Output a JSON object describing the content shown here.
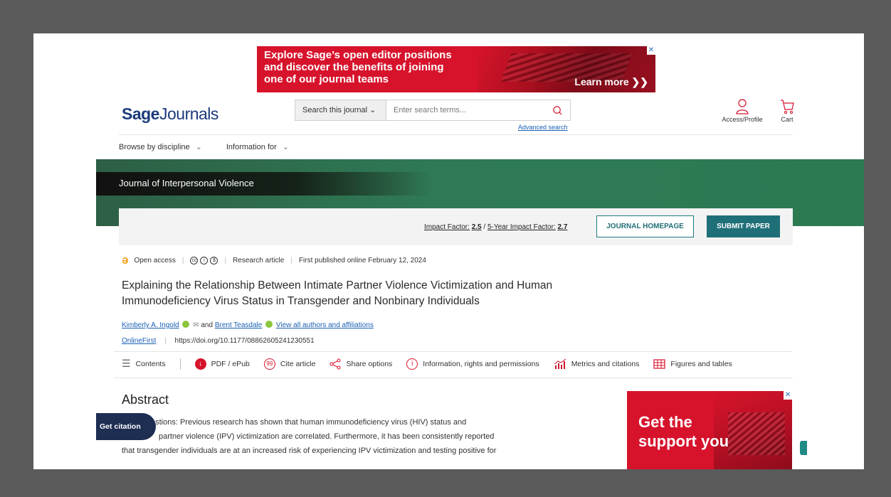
{
  "ad_banner": {
    "line1": "Explore Sage’s open editor positions",
    "line2": "and discover the benefits of joining",
    "line3": "one of our journal teams",
    "cta": "Learn more ❯❯",
    "close": "✕"
  },
  "header": {
    "logo_bold": "Sage",
    "logo_rest": "Journals",
    "search_scope": "Search this journal ⌄",
    "search_placeholder": "Enter search terms...",
    "advanced_search": "Advanced search",
    "access_label": "Access/Profile",
    "cart_label": "Cart"
  },
  "nav": {
    "browse": "Browse by discipline",
    "info_for": "Information for"
  },
  "journal": {
    "name": "Journal of Interpersonal Violence",
    "impact_label": "Impact Factor:",
    "impact_value": "2.5",
    "five_year_label": "5-Year Impact Factor:",
    "five_year_value": "2.7",
    "homepage_button": "JOURNAL HOMEPAGE",
    "submit_button": "SUBMIT PAPER"
  },
  "article": {
    "access": "Open access",
    "type": "Research article",
    "published": "First published online February 12, 2024",
    "title_line1": "Explaining the Relationship Between Intimate Partner Violence Victimization and Human",
    "title_line2": "Immunodeficiency Virus Status in Transgender and Nonbinary Individuals",
    "author1": "Kimberly A. Ingold",
    "and": "and",
    "author2": "Brent Teasdale",
    "all_authors": "View all authors and affiliations",
    "status": "OnlineFirst",
    "doi": "https://doi.org/10.1177/08862605241230551"
  },
  "tools": {
    "contents": "Contents",
    "pdf": "PDF / ePub",
    "cite": "Cite article",
    "share": "Share options",
    "info": "Information, rights and permissions",
    "metrics": "Metrics and citations",
    "figures": "Figures and tables"
  },
  "abstract": {
    "heading": "Abstract",
    "line1": "estions: Previous research has shown that human immunodeficiency virus (HIV) status and",
    "line2": "partner violence (IPV) victimization are correlated. Furthermore, it has been consistently reported",
    "line3": "that transgender individuals are at an increased risk of experiencing IPV victimization and testing positive for"
  },
  "get_citation": "Get citation",
  "side_ad": {
    "line1": "Get the",
    "line2": "support you",
    "close": "✕"
  },
  "colors": {
    "brand_red": "#d7132c",
    "teal": "#1f6f78",
    "green": "#2f7a55",
    "navy": "#1e2d52"
  }
}
